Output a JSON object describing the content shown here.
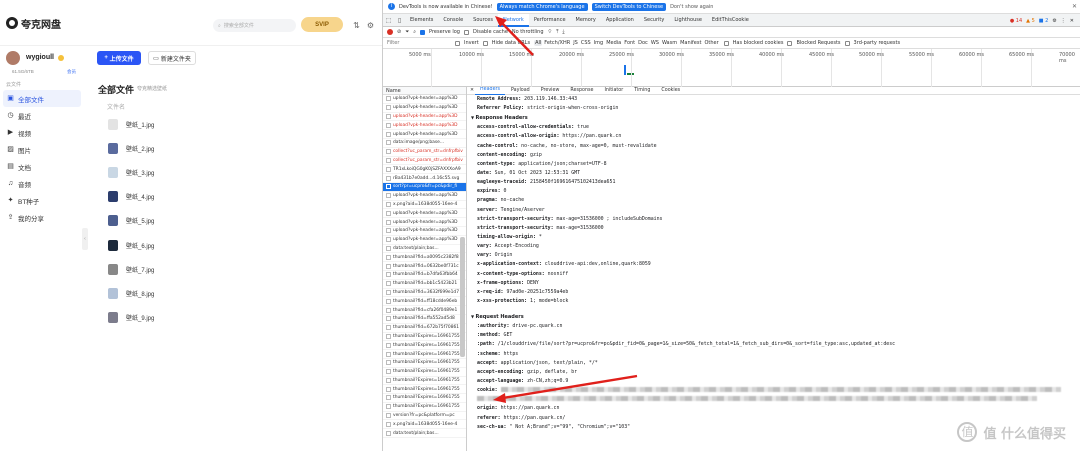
{
  "app": {
    "logo": "夸克网盘",
    "search_placeholder": "搜索全部文件",
    "svip": "SVIP",
    "user": {
      "name": "wygioull",
      "quota": "61.5G/6TB",
      "quota_link": "会员"
    },
    "sidebar_header": "云文件",
    "sidebar": [
      {
        "label": "全部文件",
        "icon": "folder-icon",
        "active": true
      },
      {
        "label": "最近",
        "icon": "clock-icon"
      },
      {
        "label": "视频",
        "icon": "video-icon"
      },
      {
        "label": "图片",
        "icon": "image-icon"
      },
      {
        "label": "文档",
        "icon": "document-icon"
      },
      {
        "label": "音频",
        "icon": "audio-icon"
      },
      {
        "label": "BT种子",
        "icon": "bt-icon"
      },
      {
        "label": "我的分享",
        "icon": "share-icon"
      }
    ],
    "upload_label": "上传文件",
    "new_folder_label": "新建文件夹",
    "section_title": "全部文件",
    "section_sub": "夸克精选壁纸",
    "column_header": "文件名",
    "files": [
      {
        "name": "壁纸_1.jpg",
        "color": "#e3e3e3"
      },
      {
        "name": "壁纸_2.jpg",
        "color": "#5a6b9e"
      },
      {
        "name": "壁纸_3.jpg",
        "color": "#c9d7e4"
      },
      {
        "name": "壁纸_4.jpg",
        "color": "#2c3d6d"
      },
      {
        "name": "壁纸_5.jpg",
        "color": "#4d5f8f"
      },
      {
        "name": "壁纸_6.jpg",
        "color": "#1d2a3c"
      },
      {
        "name": "壁纸_7.jpg",
        "color": "#888888"
      },
      {
        "name": "壁纸_8.jpg",
        "color": "#b2c2d8"
      },
      {
        "name": "壁纸_9.jpg",
        "color": "#7c7c8c"
      }
    ]
  },
  "devtools": {
    "infobar": {
      "text": "DevTools is now available in Chinese!",
      "btn1": "Always match Chrome's language",
      "btn2": "Switch DevTools to Chinese",
      "link": "Don't show again"
    },
    "tabs": [
      "Elements",
      "Console",
      "Sources",
      "Network",
      "Performance",
      "Memory",
      "Application",
      "Security",
      "Lighthouse",
      "EditThisCookie"
    ],
    "active_tab": "Network",
    "badges": {
      "errors": "14",
      "warnings": "5",
      "info": "2"
    },
    "toolbar": {
      "preserve_log": "Preserve log",
      "disable_cache": "Disable cache",
      "throttling": "No throttling"
    },
    "filter": {
      "placeholder": "Filter",
      "invert": "Invert",
      "hide_data_urls": "Hide data URLs",
      "types": [
        "All",
        "Fetch/XHR",
        "JS",
        "CSS",
        "Img",
        "Media",
        "Font",
        "Doc",
        "WS",
        "Wasm",
        "Manifest",
        "Other"
      ],
      "blocked_cookies": "Has blocked cookies",
      "blocked_requests": "Blocked Requests",
      "third_party": "3rd-party requests"
    },
    "timeline_ticks": [
      "5000 ms",
      "10000 ms",
      "15000 ms",
      "20000 ms",
      "25000 ms",
      "30000 ms",
      "35000 ms",
      "40000 ms",
      "45000 ms",
      "50000 ms",
      "55000 ms",
      "60000 ms",
      "65000 ms",
      "70000 ms"
    ],
    "list_header": "Name",
    "requests": [
      {
        "name": "upload?vpk-header=app%3D",
        "status": "normal"
      },
      {
        "name": "upload?vpk-header=app%3D",
        "status": "normal"
      },
      {
        "name": "upload?vpk-header=app%3D",
        "status": "err"
      },
      {
        "name": "upload?vpk-header=app%3D",
        "status": "err"
      },
      {
        "name": "upload?vpk-header=app%3D",
        "status": "normal"
      },
      {
        "name": "data:image/png;base...",
        "status": "normal"
      },
      {
        "name": "collect?uc_param_str=dnfrpfbiv",
        "status": "err"
      },
      {
        "name": "collect?uc_param_str=dnfrpfbiv",
        "status": "err"
      },
      {
        "name": "TR1xLkoiQG0gK0jSZFAXXXoA9",
        "status": "normal"
      },
      {
        "name": "rBa431b7e0add...d.16c55.svg",
        "status": "normal"
      },
      {
        "name": "sort?pr=ucpro&fr=pc&pdir_fi",
        "status": "sel"
      },
      {
        "name": "upload?vpk-header=app%3D",
        "status": "normal"
      },
      {
        "name": "x.png?aid=1638d055-16ee-4",
        "status": "normal"
      },
      {
        "name": "upload?vpk-header=app%3D",
        "status": "normal"
      },
      {
        "name": "upload?vpk-header=app%3D",
        "status": "normal"
      },
      {
        "name": "upload?vpk-header=app%3D",
        "status": "normal"
      },
      {
        "name": "upload?vpk-header=app%3D",
        "status": "normal"
      },
      {
        "name": "data:text/plain;bas...",
        "status": "normal"
      },
      {
        "name": "thumbnail?fid=a0095c2382f8",
        "status": "normal"
      },
      {
        "name": "thumbnail?fid=0632be0f731c",
        "status": "normal"
      },
      {
        "name": "thumbnail?fid=b7dfa63fbb64",
        "status": "normal"
      },
      {
        "name": "thumbnail?fid=bb1c5423b21",
        "status": "normal"
      },
      {
        "name": "thumbnail?fid=3632f699e1d7",
        "status": "normal"
      },
      {
        "name": "thumbnail?fid=ff18cdde96eb",
        "status": "normal"
      },
      {
        "name": "thumbnail?fid=cfa26f0489e1",
        "status": "normal"
      },
      {
        "name": "thumbnail?fid=ffa552ad5d8",
        "status": "normal"
      },
      {
        "name": "thumbnail?fid=672b75f70861",
        "status": "normal"
      },
      {
        "name": "thumbnail?Expires=16961755",
        "status": "normal"
      },
      {
        "name": "thumbnail?Expires=16961755",
        "status": "normal"
      },
      {
        "name": "thumbnail?Expires=16961755",
        "status": "normal"
      },
      {
        "name": "thumbnail?Expires=16961755",
        "status": "normal"
      },
      {
        "name": "thumbnail?Expires=16961755",
        "status": "normal"
      },
      {
        "name": "thumbnail?Expires=16961755",
        "status": "normal"
      },
      {
        "name": "thumbnail?Expires=16961755",
        "status": "normal"
      },
      {
        "name": "thumbnail?Expires=16961755",
        "status": "normal"
      },
      {
        "name": "thumbnail?Expires=16961755",
        "status": "normal"
      },
      {
        "name": "version?fr=pc&platform=pc",
        "status": "normal"
      },
      {
        "name": "x.png?aid=1638d055-16ee-4",
        "status": "normal"
      },
      {
        "name": "data:text/plain;bas...",
        "status": "normal"
      }
    ],
    "detail_tabs": [
      "Headers",
      "Payload",
      "Preview",
      "Response",
      "Initiator",
      "Timing",
      "Cookies"
    ],
    "general": [
      {
        "k": "Remote Address:",
        "v": "203.119.146.33:443"
      },
      {
        "k": "Referrer Policy:",
        "v": "strict-origin-when-cross-origin"
      }
    ],
    "response_headers_title": "Response Headers",
    "response_headers": [
      {
        "k": "access-control-allow-credentials:",
        "v": "true"
      },
      {
        "k": "access-control-allow-origin:",
        "v": "https://pan.quark.cn"
      },
      {
        "k": "cache-control:",
        "v": "no-cache, no-store, max-age=0, must-revalidate"
      },
      {
        "k": "content-encoding:",
        "v": "gzip"
      },
      {
        "k": "content-type:",
        "v": "application/json;charset=UTF-8"
      },
      {
        "k": "date:",
        "v": "Sun, 01 Oct 2023 12:53:31 GMT"
      },
      {
        "k": "eagleeye-traceid:",
        "v": "2158450f169616475102413dea651"
      },
      {
        "k": "expires:",
        "v": "0"
      },
      {
        "k": "pragma:",
        "v": "no-cache"
      },
      {
        "k": "server:",
        "v": "Tengine/Aserver"
      },
      {
        "k": "strict-transport-security:",
        "v": "max-age=31536000 ; includeSubDomains"
      },
      {
        "k": "strict-transport-security:",
        "v": "max-age=31536000"
      },
      {
        "k": "timing-allow-origin:",
        "v": "*"
      },
      {
        "k": "vary:",
        "v": "Accept-Encoding"
      },
      {
        "k": "vary:",
        "v": "Origin"
      },
      {
        "k": "x-application-context:",
        "v": "clouddrive-api:dev,online,quark:8059"
      },
      {
        "k": "x-content-type-options:",
        "v": "nosniff"
      },
      {
        "k": "x-frame-options:",
        "v": "DENY"
      },
      {
        "k": "x-req-id:",
        "v": "97ad0e-20251c7559a4eb"
      },
      {
        "k": "x-xss-protection:",
        "v": "1; mode=block"
      }
    ],
    "request_headers_title": "Request Headers",
    "request_headers": [
      {
        "k": ":authority:",
        "v": "drive-pc.quark.cn"
      },
      {
        "k": ":method:",
        "v": "GET"
      },
      {
        "k": ":path:",
        "v": "/1/clouddrive/file/sort?pr=ucpro&fr=pc&pdir_fid=0&_page=1&_size=50&_fetch_total=1&_fetch_sub_dirs=0&_sort=file_type:asc,updated_at:desc"
      },
      {
        "k": ":scheme:",
        "v": "https"
      },
      {
        "k": "accept:",
        "v": "application/json, text/plain, */*"
      },
      {
        "k": "accept-encoding:",
        "v": "gzip, deflate, br"
      },
      {
        "k": "accept-language:",
        "v": "zh-CN,zh;q=0.9"
      },
      {
        "k": "cookie:",
        "v": ""
      },
      {
        "k": "",
        "v": ""
      },
      {
        "k": "origin:",
        "v": "https://pan.quark.cn"
      },
      {
        "k": "referer:",
        "v": "https://pan.quark.cn/"
      },
      {
        "k": "sec-ch-ua:",
        "v": "\" Not A;Brand\";v=\"99\", \"Chromium\";v=\"103\""
      }
    ]
  },
  "watermark": "值 什么值得买"
}
